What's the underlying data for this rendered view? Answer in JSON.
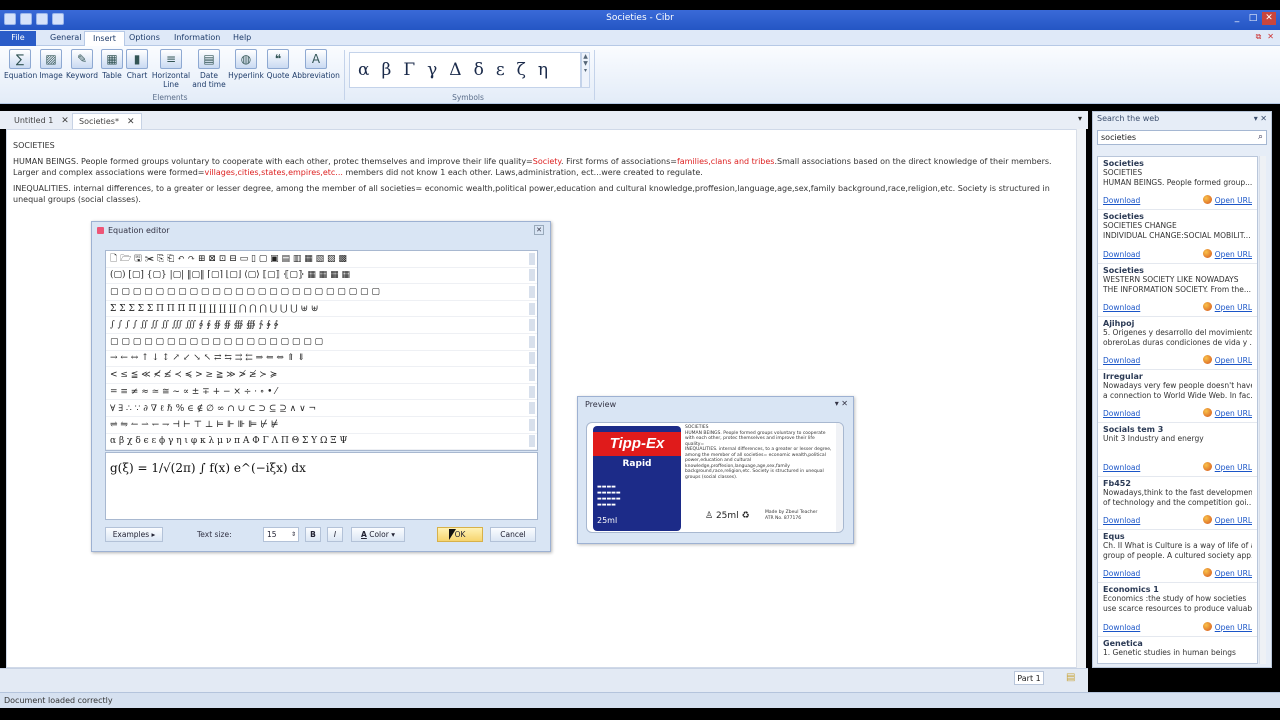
{
  "app": {
    "title": "Societies - Cibr"
  },
  "menu": {
    "file": "File",
    "tabs": [
      "General",
      "Insert",
      "Options",
      "Information",
      "Help"
    ],
    "selected": "Insert"
  },
  "ribbon": {
    "buttons": [
      "Equation",
      "Image",
      "Keyword",
      "Table",
      "Chart",
      "Horizontal Line",
      "Date and time",
      "Hyperlink",
      "Quote",
      "Abbreviation"
    ],
    "elements_group": "Elements",
    "symbols_group": "Symbols",
    "symbols": [
      "α",
      "β",
      "Γ",
      "γ",
      "Δ",
      "δ",
      "ε",
      "ζ",
      "η"
    ]
  },
  "doc_tabs": [
    {
      "label": "Untitled 1"
    },
    {
      "label": "Societies*"
    }
  ],
  "document": {
    "heading": "SOCIETIES",
    "p1_a": "HUMAN BEINGS. People formed groups voluntary to cooperate with each other, protec themselves and improve their life quality=",
    "p1_red1": "Society",
    "p1_b": ". First forms of associations=",
    "p1_red2": "families,clans and tribes",
    "p1_c": ".Small associations based on the direct knowledge of their members. Larger and complex associations were formed=",
    "p1_red3": "villages,cities,states,empires,etc...",
    "p1_d": " members did not know 1 each other. Laws,administration, ect...were created to regulate.",
    "p2": "INEQUALITIES. internal differences, to a greater or lesser degree, among the member of all societies= economic wealth,political power,education and cultural knowledge,proffesion,language,age,sex,family background,race,religion,etc. Society is structured in unequal groups (social classes)."
  },
  "bottom": {
    "part": "Part 1"
  },
  "status": "Document loaded correctly",
  "web_search": {
    "title": "Search the web",
    "query": "societies",
    "download": "Download",
    "open_url": "Open URL",
    "results": [
      {
        "title": "Societies",
        "l1": "SOCIETIES",
        "l2": "HUMAN BEINGS. People formed group..."
      },
      {
        "title": "Societies",
        "l1": "SOCIETIES CHANGE",
        "l2": "INDIVIDUAL CHANGE:SOCIAL MOBILIT..."
      },
      {
        "title": "Societies",
        "l1": "WESTERN SOCIETY LIKE NOWADAYS",
        "l2": "THE INFORMATION SOCIETY. From the..."
      },
      {
        "title": "Ajihpoj",
        "l1": "5. Origenes y desarrollo del movimiento",
        "l2": "obreroLas duras condiciones de vida y ..."
      },
      {
        "title": "Irregular",
        "l1": "Nowadays very few people doesn't have",
        "l2": "a connection to World Wide Web. In fac..."
      },
      {
        "title": "Socials tem 3",
        "l1": "Unit 3 Industry and energy",
        "l2": ""
      },
      {
        "title": "Fb452",
        "l1": "Nowadays,think to the fast development",
        "l2": "of technology and the competition goi..."
      },
      {
        "title": "Equs",
        "l1": "Ch. II What is Culture is a way of life of a",
        "l2": "group of people. A cultured society app..."
      },
      {
        "title": "Economics 1",
        "l1": "Economics :the study of how societies",
        "l2": "use scarce resources to produce valuabl..."
      },
      {
        "title": "Genetica",
        "l1": "1. Genetic studies in human beings",
        "l2": ""
      }
    ]
  },
  "equation_editor": {
    "title": "Equation editor",
    "palette_rows": [
      "🗋 🗁 🖫 ✂ ⎘ ⎗ ↶ ↷ ⊞ ⊠ ⊡ ⊟ ▭ ▯ ▢ ▣ ▤ ▥ ▦ ▧ ▨ ▩",
      "(▢) [▢] {▢} |▢| ‖▢‖ ⌈▢⌉ ⌊▢⌋ ⟨▢⟩ ⟦▢⟧ ⦃▢⦄ ▦ ▦ ▦ ▦",
      "▢ ▢ ▢ ▢ ▢ ▢ ▢ ▢ ▢ ▢ ▢ ▢ ▢ ▢ ▢ ▢ ▢ ▢ ▢ ▢ ▢ ▢ ▢ ▢",
      "Σ Σ Σ Σ Σ Π Π Π Π ∐ ∐ ∐ ∐ ⋂ ⋂ ⋂ ⋃ ⋃ ⋃ ⊎ ⊎",
      "∫ ∫ ∫ ∫ ∬ ∬ ∬ ∭ ∭ ∮ ∮ ∯ ∯ ∰ ∰ ∱ ∲ ∳",
      "▢ ▢ ▢ ▢ ▢ ▢ ▢ ▢ ▢ ▢ ▢ ▢ ▢ ▢ ▢ ▢ ▢ ▢ ▢",
      "→ ← ↔ ↑ ↓ ↕ ↗ ↙ ↘ ↖ ⇄ ⇆ ⇉ ⇇ ⇒ ⇐ ⇔ ⇑ ⇓",
      "< ≤ ≦ ≪ ≮ ≰ ≺ ≼ > ≥ ≧ ≫ ≯ ≱ ≻ ≽",
      "= ≡ ≠ ≈ ≃ ≅ ~ ∝ ± ∓ + − × ÷ · ∘ • ⁄",
      "∀ ∃ ∴ ∵ ∂ ∇ ℓ ℏ % ∈ ∉ ∅ ∞ ∩ ∪ ⊂ ⊃ ⊆ ⊇ ∧ ∨ ¬",
      "⇌ ⇋ ↼ ⇀ ↽ ⇁ ⊣ ⊢ ⊤ ⊥ ⊨ ⊩ ⊪ ⊫ ⊬ ⊭",
      "α β χ δ ϵ ε ϕ γ η ι φ κ λ μ ν π Α Φ Γ Λ Π Θ Σ Υ Ω Ξ Ψ"
    ],
    "equation": "g(ξ) = 1/√(2π) ∫ f(x) e^(−iξx) dx",
    "examples": "Examples",
    "text_size_label": "Text size:",
    "text_size_value": "15",
    "bold": "B",
    "italic": "I",
    "color": "Color",
    "ok": "OK",
    "cancel": "Cancel"
  },
  "preview": {
    "title": "Preview",
    "brand": "Tipp-Ex",
    "product": "Rapid",
    "volume": "25ml",
    "volume2": "25ml",
    "made_by": "Made by Zbeul Teacher",
    "code": "ATR No. 877176",
    "body_heading": "SOCIETIES"
  }
}
